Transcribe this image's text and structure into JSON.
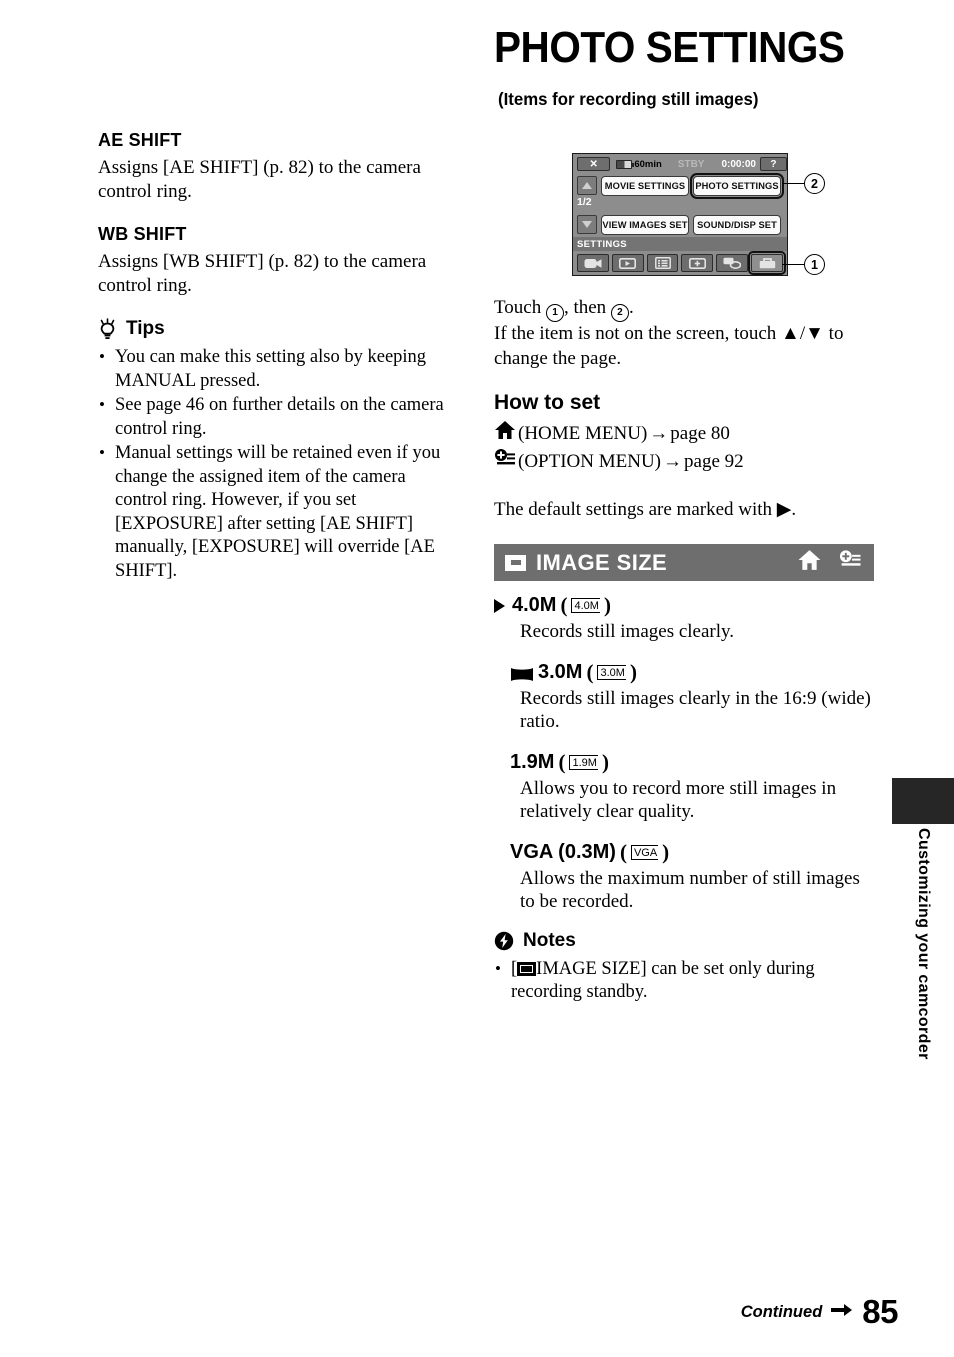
{
  "header": {
    "title": "PHOTO SETTINGS",
    "subtitle": "(Items for recording still images)"
  },
  "left_column": {
    "items": [
      {
        "heading": "AE SHIFT",
        "body": "Assigns [AE SHIFT] (p. 82) to the camera control ring."
      },
      {
        "heading": "WB SHIFT",
        "body": "Assigns [WB SHIFT] (p. 82) to the camera control ring."
      }
    ],
    "tips": {
      "icon": "lightbulb-icon",
      "label": "Tips",
      "bullets": [
        "You can make this setting also by keeping MANUAL pressed.",
        "See page 46 on further details on the camera control ring.",
        "Manual settings will be retained even if you change the assigned item of the camera control ring. However, if you set [EXPOSURE] after setting [AE SHIFT] manually, [EXPOSURE] will override [AE SHIFT]."
      ]
    }
  },
  "lcd_figure": {
    "status_bar": {
      "close_label": "✕",
      "battery_text": "60min",
      "mode_text": "STBY",
      "timecode": "0:00:00",
      "help_label": "?"
    },
    "page_indicator": "1/2",
    "menu_buttons": [
      "MOVIE SETTINGS",
      "PHOTO SETTINGS",
      "VIEW IMAGES SET",
      "SOUND/DISP SET"
    ],
    "settings_label": "SETTINGS",
    "tab_icons": [
      "camcorder-icon",
      "playback-icon",
      "manage-media-icon",
      "others-icon",
      "edit-icon",
      "toolbox-icon"
    ],
    "callouts": [
      "1",
      "2"
    ]
  },
  "instructions": {
    "line1_pre": "Touch ",
    "line1_mid": ", then ",
    "line1_post": ".",
    "circle_first": "1",
    "circle_second": "2",
    "line2": "If the item is not on the screen, touch ▲/▼ to change the page."
  },
  "how_to_set": {
    "heading": "How to set",
    "home_menu": {
      "icon": "home-icon",
      "label": "(HOME MENU)",
      "arrow": "→",
      "page": "page 80"
    },
    "option_menu": {
      "icon": "option-icon",
      "label": "(OPTION MENU)",
      "arrow": "→",
      "page": "page 92"
    },
    "default_note": "The default settings are marked with ▶."
  },
  "image_size": {
    "bar_icon": "photo-size-icon",
    "bar_title": "IMAGE SIZE",
    "bar_color": "#6e6e6e",
    "bar_actions": [
      "home-icon",
      "option-icon"
    ],
    "options": [
      {
        "is_default": true,
        "wide": false,
        "label": "4.0M",
        "badge": "4.0M",
        "desc": "Records still images clearly."
      },
      {
        "is_default": false,
        "wide": true,
        "label": "3.0M",
        "badge": "3.0M",
        "desc": "Records still images clearly in the 16:9 (wide) ratio."
      },
      {
        "is_default": false,
        "wide": false,
        "label": "1.9M",
        "badge": "1.9M",
        "desc": "Allows you to record more still images in relatively clear quality."
      },
      {
        "is_default": false,
        "wide": false,
        "label": "VGA (0.3M)",
        "badge": "VGA",
        "desc": "Allows the maximum number of still images to be recorded."
      }
    ],
    "notes": {
      "icon": "notes-icon",
      "label": "Notes",
      "bullet_pre": "[",
      "bullet_post": "IMAGE SIZE] can be set only during recording standby."
    }
  },
  "side_tab": {
    "text": "Customizing your camcorder",
    "block_color": "#262626"
  },
  "footer": {
    "continued": "Continued",
    "arrow": "➜",
    "page_number": "85"
  }
}
